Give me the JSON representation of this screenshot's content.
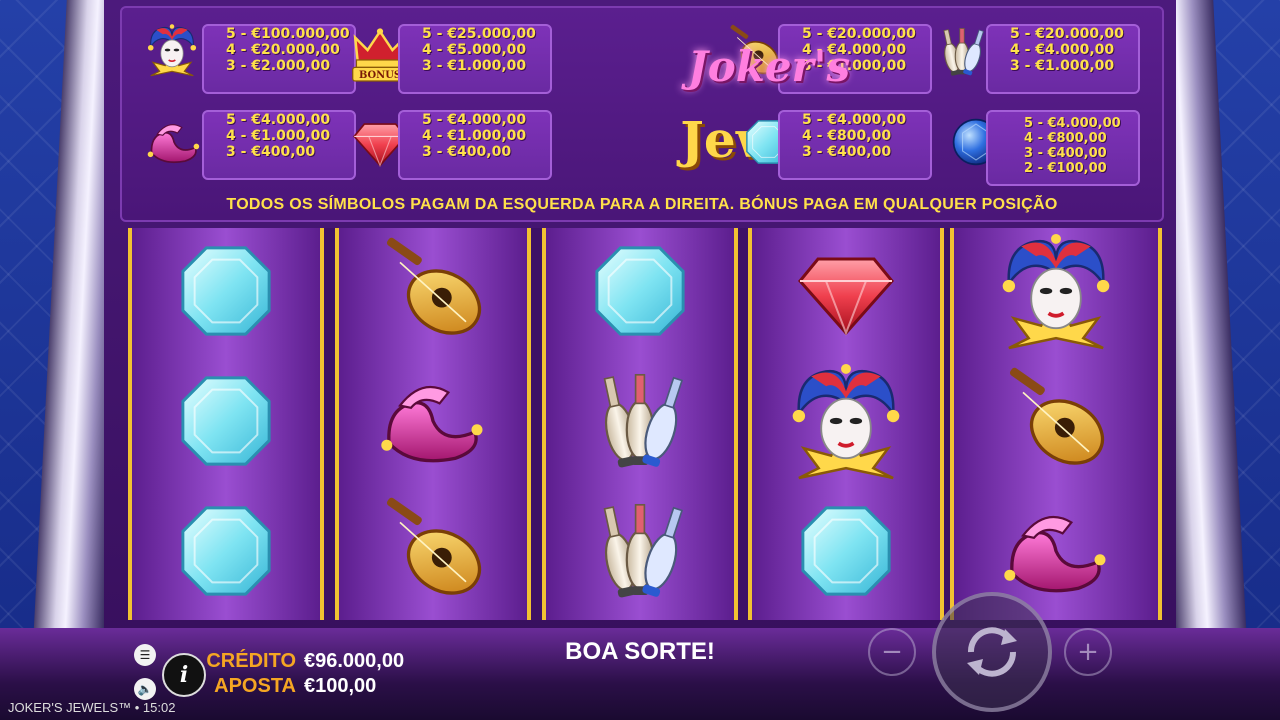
{
  "game": {
    "title": "JOKER'S JEWELS™",
    "time": "15:02",
    "logo_line1": "Joker's",
    "logo_line2": "Jewels",
    "trademark": "™"
  },
  "paytable": {
    "note": "TODOS OS SÍMBOLOS PAGAM DA ESQUERDA PARA A DIREITA. BÓNUS PAGA EM QUALQUER POSIÇÃO",
    "symbols": [
      {
        "name": "joker",
        "pays": [
          "5 - €100.000,00",
          "4 - €20.000,00",
          "3 - €2.000,00"
        ]
      },
      {
        "name": "crown-bonus",
        "badge": "BONUS",
        "pays": [
          "5 - €25.000,00",
          "4 - €5.000,00",
          "3 - €1.000,00"
        ]
      },
      {
        "name": "lute",
        "pays": [
          "5 - €20.000,00",
          "4 - €4.000,00",
          "3 - €1.000,00"
        ]
      },
      {
        "name": "juggling-pins",
        "pays": [
          "5 - €20.000,00",
          "4 - €4.000,00",
          "3 - €1.000,00"
        ]
      },
      {
        "name": "jester-shoes",
        "pays": [
          "5 - €4.000,00",
          "4 - €1.000,00",
          "3 - €400,00"
        ]
      },
      {
        "name": "red-gem",
        "pays": [
          "5 - €4.000,00",
          "4 - €1.000,00",
          "3 - €400,00"
        ]
      },
      {
        "name": "cyan-gem",
        "pays": [
          "5 - €4.000,00",
          "4 - €800,00",
          "3 - €400,00"
        ]
      },
      {
        "name": "blue-orb",
        "pays": [
          "5 - €4.000,00",
          "4 - €800,00",
          "3 - €400,00",
          "2 - €100,00"
        ]
      }
    ]
  },
  "reels": [
    [
      "cyan-gem",
      "cyan-gem",
      "cyan-gem"
    ],
    [
      "lute",
      "jester-shoes",
      "lute"
    ],
    [
      "cyan-gem",
      "juggling-pins",
      "juggling-pins"
    ],
    [
      "red-gem",
      "joker",
      "cyan-gem"
    ],
    [
      "joker",
      "lute",
      "jester-shoes"
    ]
  ],
  "status": {
    "message": "BOA SORTE!",
    "credit_label": "CRÉDITO",
    "credit_value": "€96.000,00",
    "bet_label": "APOSTA",
    "bet_value": "€100,00"
  },
  "controls": {
    "menu_icon": "menu-icon",
    "sound_icon": "sound-icon",
    "info_icon": "info-icon",
    "info_glyph": "i",
    "minus_glyph": "−",
    "plus_glyph": "+",
    "spin_icon": "spin-arrows-icon"
  },
  "colors": {
    "gold": "#ffe14a",
    "label_orange": "#f5a623",
    "purple": "#5b1f8f"
  }
}
